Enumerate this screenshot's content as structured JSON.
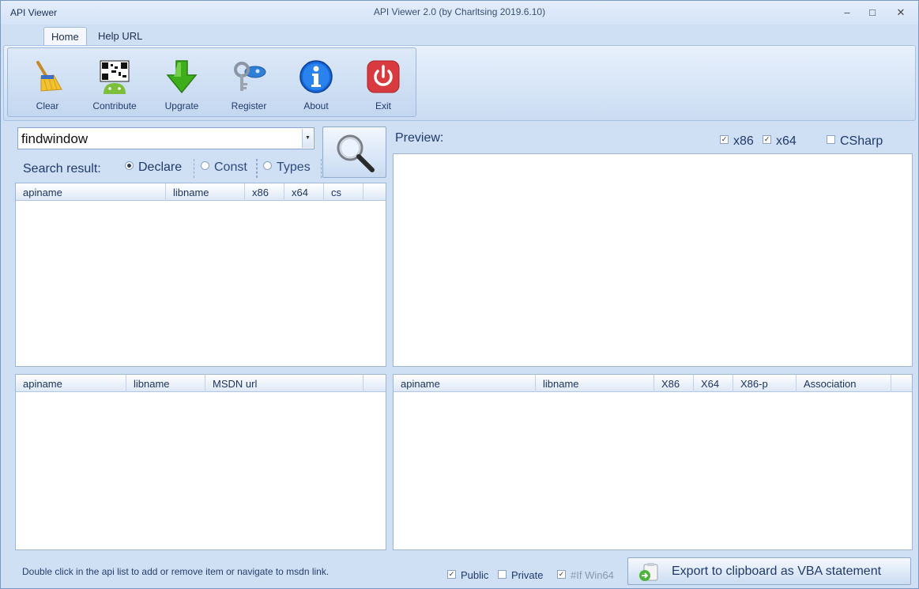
{
  "window": {
    "app_title": "API Viewer",
    "caption": "API Viewer 2.0 (by Charltsing 2019.6.10)"
  },
  "tabs": [
    {
      "label": "Home",
      "active": true
    },
    {
      "label": "Help URL",
      "active": false
    }
  ],
  "ribbon": {
    "buttons": [
      {
        "label": "Clear",
        "icon": "broom-icon"
      },
      {
        "label": "Contribute",
        "icon": "qr-android-icon"
      },
      {
        "label": "Upgrate",
        "icon": "down-arrow-icon"
      },
      {
        "label": "Register",
        "icon": "key-icon"
      },
      {
        "label": "About",
        "icon": "info-icon"
      },
      {
        "label": "Exit",
        "icon": "power-icon"
      }
    ]
  },
  "search": {
    "value": "findwindow",
    "result_label": "Search result:",
    "modes": [
      {
        "label": "Declare",
        "selected": true
      },
      {
        "label": "Const",
        "selected": false
      },
      {
        "label": "Types",
        "selected": false
      }
    ]
  },
  "results_grid": {
    "columns": [
      "apiname",
      "libname",
      "x86",
      "x64",
      "cs"
    ]
  },
  "selected_grid": {
    "columns": [
      "apiname",
      "libname",
      "MSDN url"
    ]
  },
  "preview": {
    "label": "Preview:",
    "options": [
      {
        "label": "x86",
        "checked": true
      },
      {
        "label": "x64",
        "checked": true
      },
      {
        "label": "CSharp",
        "checked": false
      }
    ]
  },
  "assoc_grid": {
    "columns": [
      "apiname",
      "libname",
      "X86",
      "X64",
      "X86-p",
      "Association"
    ]
  },
  "footer": {
    "hint": "Double click in the api list to add or remove item or navigate to msdn link.",
    "options": [
      {
        "label": "Public",
        "checked": true,
        "disabled": false
      },
      {
        "label": "Private",
        "checked": false,
        "disabled": false
      },
      {
        "label": "#If Win64",
        "checked": true,
        "disabled": true
      }
    ],
    "export_label": "Export to clipboard as VBA statement"
  }
}
